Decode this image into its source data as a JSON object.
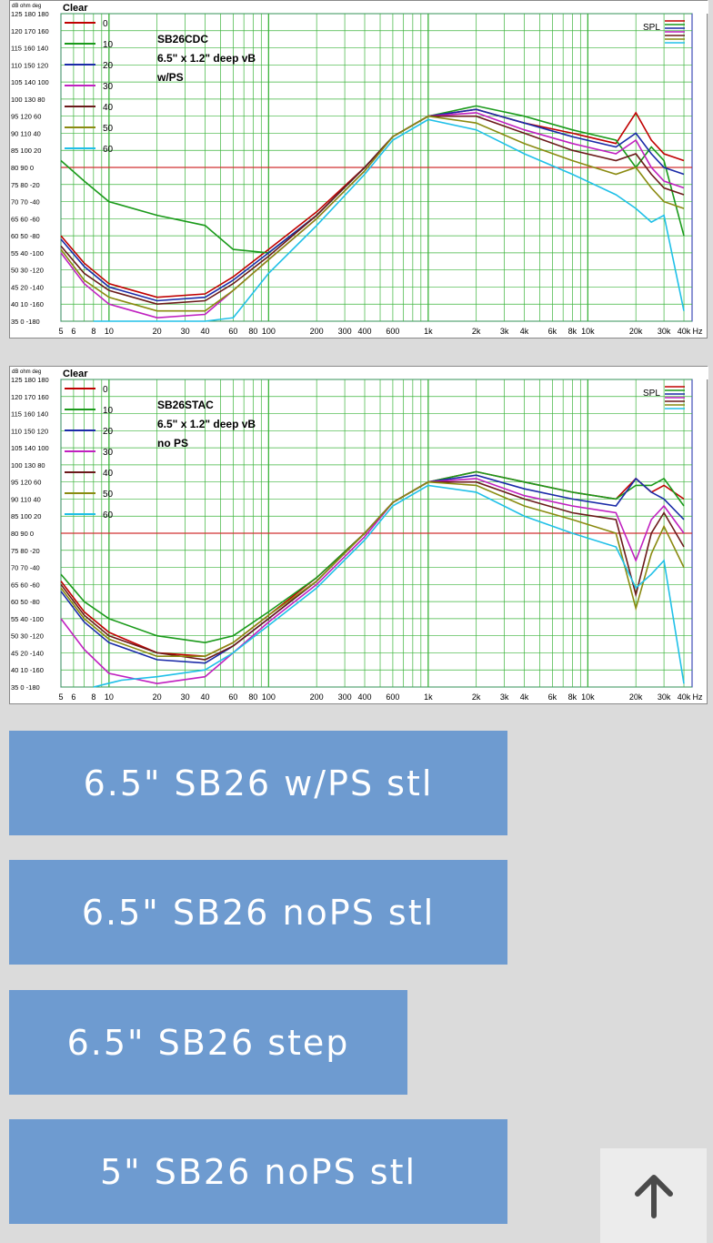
{
  "charts": [
    {
      "id": "chart1",
      "clear_label": "Clear",
      "header_labels": [
        "dB",
        "ohm",
        "deg"
      ],
      "title_lines": [
        "SB26CDC",
        "6.5\" x 1.2\" deep vB",
        "w/PS"
      ],
      "spl_label": "SPL",
      "legend": [
        {
          "label": "0",
          "color": "#c00000"
        },
        {
          "label": "10",
          "color": "#1a9a1a"
        },
        {
          "label": "20",
          "color": "#1a2aa8"
        },
        {
          "label": "30",
          "color": "#c020c0"
        },
        {
          "label": "40",
          "color": "#6b1a1a"
        },
        {
          "label": "50",
          "color": "#8a8a10"
        },
        {
          "label": "60",
          "color": "#20c0e8"
        }
      ]
    },
    {
      "id": "chart2",
      "clear_label": "Clear",
      "header_labels": [
        "dB",
        "ohm",
        "deg"
      ],
      "title_lines": [
        "SB26STAC",
        "6.5\" x 1.2\" deep vB",
        "no PS"
      ],
      "spl_label": "SPL",
      "legend": [
        {
          "label": "0",
          "color": "#c00000"
        },
        {
          "label": "10",
          "color": "#1a9a1a"
        },
        {
          "label": "20",
          "color": "#1a2aa8"
        },
        {
          "label": "30",
          "color": "#c020c0"
        },
        {
          "label": "40",
          "color": "#6b1a1a"
        },
        {
          "label": "50",
          "color": "#8a8a10"
        },
        {
          "label": "60",
          "color": "#20c0e8"
        }
      ]
    }
  ],
  "y_ticks": [
    "125 180 180",
    "120 170 160",
    "115 160 140",
    "110 150 120",
    "105 140 100",
    "100 130 80",
    "95 120 60",
    "90 110 40",
    "85 100 20",
    "80 90 0",
    "75 80 -20",
    "70 70 -40",
    "65 60 -60",
    "60 50 -80",
    "55 40 -100",
    "50 30 -120",
    "45 20 -140",
    "40 10 -160",
    "35 0 -180"
  ],
  "x_ticks": [
    {
      "label": "5",
      "f": 5
    },
    {
      "label": "6",
      "f": 6
    },
    {
      "label": "8",
      "f": 8
    },
    {
      "label": "10",
      "f": 10
    },
    {
      "label": "20",
      "f": 20
    },
    {
      "label": "30",
      "f": 30
    },
    {
      "label": "40",
      "f": 40
    },
    {
      "label": "60",
      "f": 60
    },
    {
      "label": "80",
      "f": 80
    },
    {
      "label": "100",
      "f": 100
    },
    {
      "label": "200",
      "f": 200
    },
    {
      "label": "300",
      "f": 300
    },
    {
      "label": "400",
      "f": 400
    },
    {
      "label": "600",
      "f": 600
    },
    {
      "label": "1k",
      "f": 1000
    },
    {
      "label": "2k",
      "f": 2000
    },
    {
      "label": "3k",
      "f": 3000
    },
    {
      "label": "4k",
      "f": 4000
    },
    {
      "label": "6k",
      "f": 6000
    },
    {
      "label": "8k",
      "f": 8000
    },
    {
      "label": "10k",
      "f": 10000
    },
    {
      "label": "20k",
      "f": 20000
    },
    {
      "label": "30k",
      "f": 30000
    },
    {
      "label": "40k",
      "f": 40000
    },
    {
      "label": "Hz",
      "f": null
    }
  ],
  "buttons": [
    {
      "id": "btn1",
      "label": "6.5\"  SB26 w/PS stl"
    },
    {
      "id": "btn2",
      "label": "6.5\"  SB26 noPS stl"
    },
    {
      "id": "btn3",
      "label": "6.5\"  SB26 step"
    },
    {
      "id": "btn4",
      "label": "5\"  SB26 noPS stl"
    }
  ],
  "scroll_top_icon": "arrow-up-icon",
  "colors": {
    "button_bg": "#6e9bd0",
    "page_bg": "#dbdbdb",
    "grid": "#3cb43c",
    "reference_line": "#d03030"
  }
}
